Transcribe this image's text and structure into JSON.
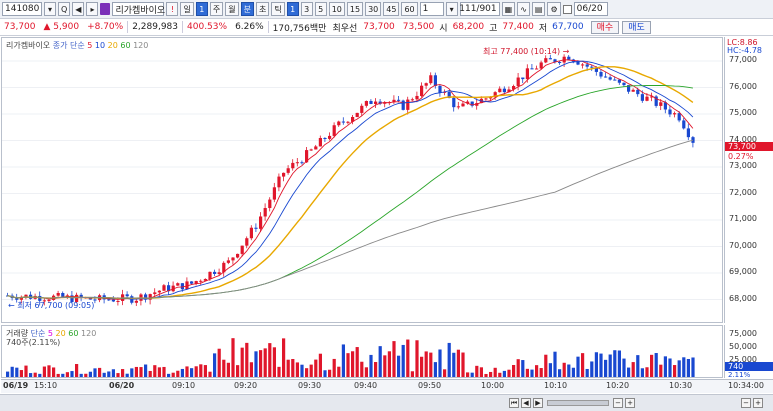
{
  "toolbar": {
    "code": "141080",
    "name": "리가켐바이오",
    "warn": "!",
    "period": "일",
    "period_num": "1",
    "tabs": [
      "주",
      "월",
      "분",
      "초",
      "틱"
    ],
    "minutes": [
      "1",
      "3",
      "5",
      "10",
      "15",
      "30",
      "45",
      "60"
    ],
    "count": "1",
    "paging": "111/901",
    "date": "06/20"
  },
  "quote": {
    "price": "73,700",
    "change": "▲ 5,900",
    "pct": "+8.70%",
    "volume": "2,289,983",
    "vol_ratio": "400.53%",
    "turnover": "6.26%",
    "amount": "170,756백만",
    "ask_label": "최우선",
    "ask1": "73,700",
    "bid1": "73,500",
    "open_label": "시",
    "open": "68,200",
    "high_label": "고",
    "high": "77,400",
    "low_label": "저",
    "low": "67,700",
    "buy": "매수",
    "sell": "매도"
  },
  "price_legend": {
    "name": "리가켐바이오",
    "ma_title": "종가 단순",
    "ma": [
      {
        "label": "5",
        "color": "#e0162b"
      },
      {
        "label": "10",
        "color": "#1948d0"
      },
      {
        "label": "20",
        "color": "#e8a800"
      },
      {
        "label": "60",
        "color": "#2aa52a"
      },
      {
        "label": "120",
        "color": "#888888"
      }
    ]
  },
  "volume_legend": {
    "name": "거래량",
    "ma_title": "단순",
    "ma": [
      {
        "label": "5",
        "color": "#e000e0"
      },
      {
        "label": "20",
        "color": "#e8a800"
      },
      {
        "label": "60",
        "color": "#2aa52a"
      },
      {
        "label": "120",
        "color": "#888888"
      }
    ],
    "current": "740주(2.11%)"
  },
  "annotations": {
    "high": "최고 77,400 (10:14)",
    "low": "최저 67,700 (09:05)",
    "lc": "LC:8.86",
    "hc": "HC:-4.78",
    "last_price": "73,700",
    "last_pct": "0.27%",
    "vol_last": "740",
    "vol_pct": "2.11%"
  },
  "price_ticks": [
    "77,000",
    "76,000",
    "75,000",
    "74,000",
    "73,000",
    "72,000",
    "71,000",
    "70,000",
    "69,000",
    "68,000"
  ],
  "volume_ticks": [
    "75,000",
    "50,000",
    "25,000"
  ],
  "time_labels": [
    "06/19",
    "15:10",
    "06/20",
    "09:10",
    "09:20",
    "09:30",
    "09:40",
    "09:50",
    "10:00",
    "10:10",
    "10:20",
    "10:30",
    "10:34:00"
  ],
  "chart_data": {
    "type": "candlestick",
    "y_range": [
      67700,
      77400
    ],
    "open": 68200,
    "high": 77400,
    "low": 67700,
    "last": 73700,
    "high_time": "10:14",
    "low_time": "09:05",
    "series": [
      {
        "name": "5",
        "color": "#e0162b"
      },
      {
        "name": "10",
        "color": "#1948d0"
      },
      {
        "name": "20",
        "color": "#e8a800"
      },
      {
        "name": "60",
        "color": "#2aa52a"
      },
      {
        "name": "120",
        "color": "#888888"
      }
    ]
  },
  "colors": {
    "up": "#e0162b",
    "down": "#1948d0"
  }
}
